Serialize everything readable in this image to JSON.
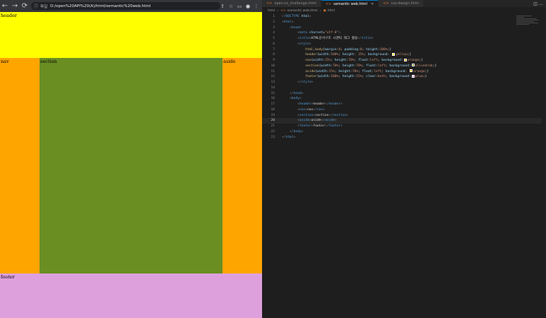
{
  "browser": {
    "info_label": "파일",
    "url": "D:/open%20API%20(A)/html/semantic%20web.html",
    "regions": {
      "header": "header",
      "nav": "nav",
      "section": "section",
      "aside": "aside",
      "footer": "footer"
    },
    "colors": {
      "header": "#ffff00",
      "nav": "#ffa500",
      "section": "#6b8e23",
      "aside": "#ffa500",
      "footer": "#dda0dd"
    }
  },
  "editor": {
    "tabs": [
      {
        "label": "open-cs_challenge.html",
        "active": false
      },
      {
        "label": "semantic web.html",
        "active": true
      },
      {
        "label": "css-design.html",
        "active": false
      }
    ],
    "breadcrumb": [
      "html",
      "semantic web.html",
      "html"
    ],
    "current_line": 20,
    "lines": [
      {
        "n": "1",
        "i": "",
        "h": "<span class='g'>&lt;</span><span class='t'>!DOCTYPE</span> <span class='a'>html</span><span class='g'>&gt;</span>"
      },
      {
        "n": "2",
        "i": "",
        "h": "<span class='g'>&lt;</span><span class='t'>html</span><span class='g'>&gt;</span>"
      },
      {
        "n": "3",
        "i": "    ",
        "h": "<span class='g'>&lt;</span><span class='t'>head</span><span class='g'>&gt;</span>"
      },
      {
        "n": "4",
        "i": "        ",
        "h": "<span class='g'>&lt;</span><span class='t'>meta</span> <span class='a'>charset</span>=<span class='s'>\"utf-8\"</span><span class='g'>&gt;</span>"
      },
      {
        "n": "5",
        "i": "        ",
        "h": "<span class='g'>&lt;</span><span class='t'>title</span><span class='g'>&gt;</span>HTML문서구조 시맨틱 태그 활용<span class='g'>&lt;/</span><span class='t'>title</span><span class='g'>&gt;</span>"
      },
      {
        "n": "6",
        "i": "        ",
        "h": "<span class='g'>&lt;</span><span class='t'>style</span><span class='g'>&gt;</span>"
      },
      {
        "n": "7",
        "i": "            ",
        "h": "<span class='sel'>html</span>,<span class='sel'>body</span>{<span class='p'>margin</span>:<span class='v'>0</span>; <span class='p'>padding</span>:<span class='v'>0</span>; <span class='p'>height</span>:<span class='v'>100%</span>;}"
      },
      {
        "n": "8",
        "i": "            ",
        "h": "<span class='sel'>header</span>{<span class='p'>width</span>:<span class='v'>100%</span>; <span class='p'>height</span>: <span class='v'>15%</span>; <span class='p'>background</span>: <span class='sw' style='background:#ffff00'></span><span class='v'>yellow</span>;}"
      },
      {
        "n": "9",
        "i": "            ",
        "h": "<span class='sel'>nav</span>{<span class='p'>width</span>:<span class='v'>15%</span>; <span class='p'>height</span>:<span class='v'>70%</span>; <span class='p'>float</span>:<span class='v'>left</span>; <span class='p'>background</span>:<span class='sw' style='background:#ffa500'></span><span class='v'>orange</span>;}"
      },
      {
        "n": "10",
        "i": "            ",
        "h": "<span class='sel'>section</span>{<span class='p'>width</span>:<span class='v'>70%</span>; <span class='p'>height</span>:<span class='v'>70%</span>; <span class='p'>float</span>:<span class='v'>left</span>; <span class='p'>background</span>:<span class='sw' style='background:#6b8e23'></span><span class='v'>olivedrab</span>;}"
      },
      {
        "n": "11",
        "i": "            ",
        "h": "<span class='sel'>aside</span>{<span class='p'>width</span>:<span class='v'>15%</span>; <span class='p'>height</span>:<span class='v'>70%</span>; <span class='p'>float</span>:<span class='v'>left</span>; <span class='p'>background</span>: <span class='sw' style='background:#ffa500'></span><span class='v'>orange</span>;}"
      },
      {
        "n": "12",
        "i": "            ",
        "h": "<span class='sel'>footer</span>{<span class='p'>width</span>:<span class='v'>100%</span>; <span class='p'>height</span>:<span class='v'>15%</span>; <span class='p'>clear</span>:<span class='v'>both</span>; <span class='p'>background</span>:<span class='sw' style='background:#dda0dd'></span><span class='v'>plum</span>;}"
      },
      {
        "n": "13",
        "i": "        ",
        "h": "<span class='g'>&lt;/</span><span class='t'>style</span><span class='g'>&gt;</span>"
      },
      {
        "n": "14",
        "i": "",
        "h": ""
      },
      {
        "n": "15",
        "i": "    ",
        "h": "<span class='g'>&lt;/</span><span class='t'>head</span><span class='g'>&gt;</span>"
      },
      {
        "n": "16",
        "i": "    ",
        "h": "<span class='g'>&lt;</span><span class='t'>body</span><span class='g'>&gt;</span>"
      },
      {
        "n": "17",
        "i": "        ",
        "h": "<span class='g'>&lt;</span><span class='t'>header</span><span class='g'>&gt;</span>header<span class='g'>&lt;/</span><span class='t'>header</span><span class='g'>&gt;</span>"
      },
      {
        "n": "18",
        "i": "        ",
        "h": "<span class='g'>&lt;</span><span class='t'>nav</span><span class='g'>&gt;</span>nav<span class='g'>&lt;/</span><span class='t'>nav</span><span class='g'>&gt;</span>"
      },
      {
        "n": "19",
        "i": "        ",
        "h": "<span class='g'>&lt;</span><span class='t'>section</span><span class='g'>&gt;</span>section<span class='g'>&lt;/</span><span class='t'>section</span><span class='g'>&gt;</span>"
      },
      {
        "n": "20",
        "i": "        ",
        "h": "<span class='g'>&lt;</span><span class='t'>aside</span><span class='g'>&gt;</span>aside<span class='g'>&lt;/</span><span class='t'>aside</span><span class='g'>&gt;</span>"
      },
      {
        "n": "21",
        "i": "        ",
        "h": "<span class='g'>&lt;</span><span class='t'>footer</span><span class='g'>&gt;</span>footer<span class='g'>&lt;/</span><span class='t'>footer</span><span class='g'>&gt;</span>"
      },
      {
        "n": "22",
        "i": "    ",
        "h": "<span class='g'>&lt;/</span><span class='t'>body</span><span class='g'>&gt;</span>"
      },
      {
        "n": "23",
        "i": "",
        "h": "<span class='g'>&lt;/</span><span class='t'>html</span><span class='g'>&gt;</span>"
      }
    ]
  }
}
